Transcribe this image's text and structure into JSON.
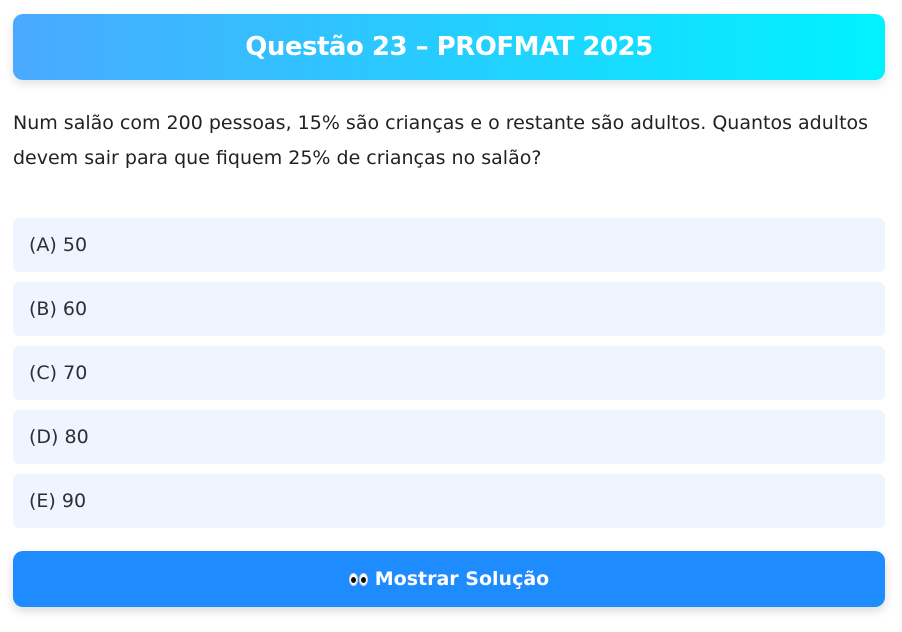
{
  "header": {
    "title": "Questão 23 – PROFMAT 2025"
  },
  "question": {
    "text": "Num salão com 200 pessoas, 15% são crianças e o restante são adultos. Quantos adultos devem sair para que fiquem 25% de crianças no salão?"
  },
  "options": [
    {
      "label": "(A) 50"
    },
    {
      "label": "(B) 60"
    },
    {
      "label": "(C) 70"
    },
    {
      "label": "(D) 80"
    },
    {
      "label": "(E) 90"
    }
  ],
  "solution_button": {
    "icon": "eyes-icon",
    "label": "Mostrar Solução"
  },
  "colors": {
    "header_gradient_start": "#4aa9ff",
    "header_gradient_end": "#00f2ff",
    "option_bg": "#eef5ff",
    "button_bg": "#1e8bff"
  }
}
